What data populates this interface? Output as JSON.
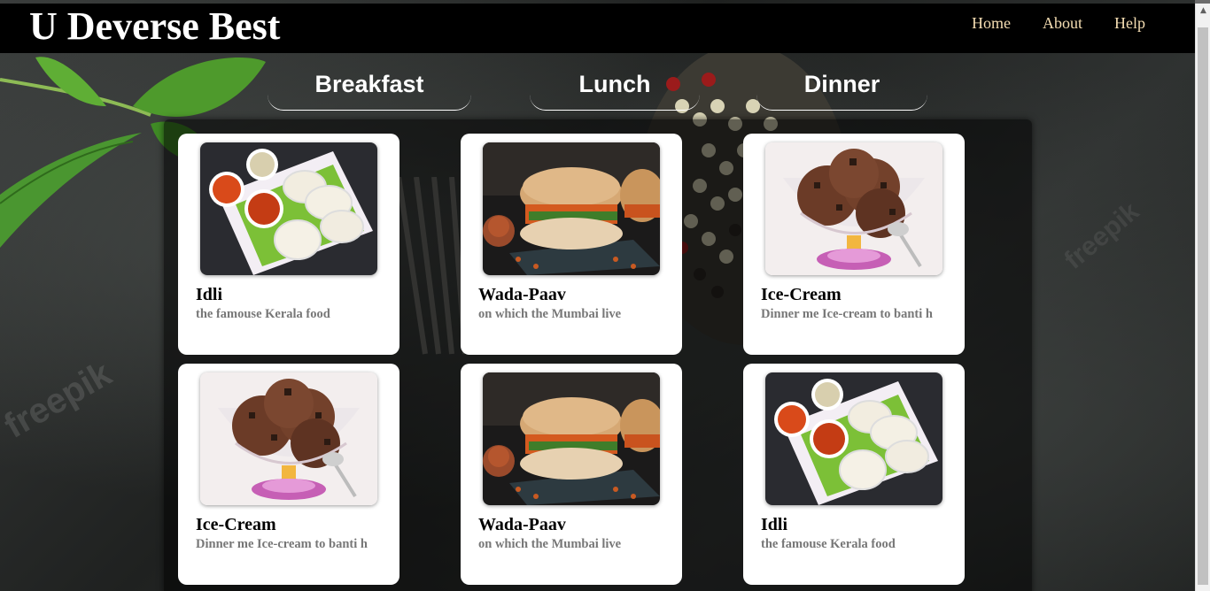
{
  "header": {
    "brand": "U Deverse Best",
    "nav": [
      "Home",
      "About",
      "Help"
    ]
  },
  "tabs": [
    "Breakfast",
    "Lunch",
    "Dinner"
  ],
  "cards": [
    {
      "title": "Idli",
      "desc": "the famouse Kerala food",
      "image": "idli-plate"
    },
    {
      "title": "Wada-Paav",
      "desc": "on which the Mumbai live",
      "image": "wada-paav"
    },
    {
      "title": "Ice-Cream",
      "desc": "Dinner me Ice-cream to banti h",
      "image": "ice-cream-cup"
    },
    {
      "title": "Ice-Cream",
      "desc": "Dinner me Ice-cream to banti h",
      "image": "ice-cream-cup"
    },
    {
      "title": "Wada-Paav",
      "desc": "on which the Mumbai live",
      "image": "wada-paav"
    },
    {
      "title": "Idli",
      "desc": "the famouse Kerala food",
      "image": "idli-plate"
    }
  ],
  "watermark": "freepik",
  "colors": {
    "nav_link": "#f5deb3",
    "header_bg": "#000000",
    "card_bg": "#ffffff",
    "desc_text": "#777777"
  }
}
